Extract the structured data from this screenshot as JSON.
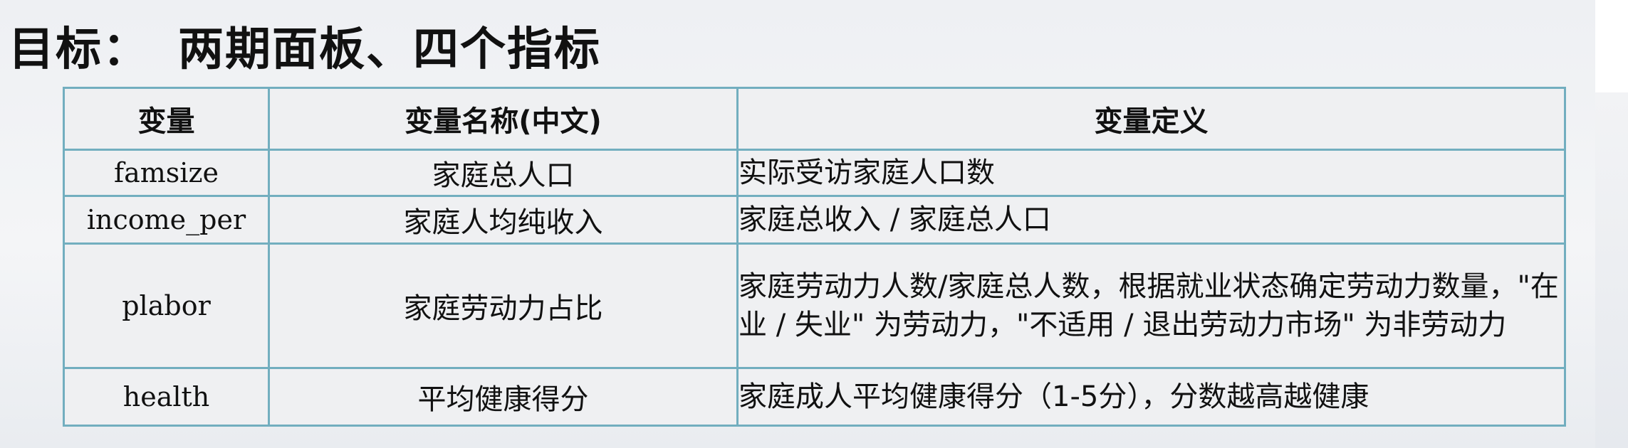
{
  "slide": {
    "title_prefix": "目标：",
    "title_main": "两期面板、四个指标"
  },
  "table": {
    "headers": [
      "变量",
      "变量名称(中文)",
      "变量定义"
    ],
    "rows": [
      {
        "variable": "famsize",
        "name_cn": "家庭总人口",
        "definition": "实际受访家庭人口数"
      },
      {
        "variable": "income_per",
        "name_cn": "家庭人均纯收入",
        "definition": "家庭总收入 / 家庭总人口"
      },
      {
        "variable": "plabor",
        "name_cn": "家庭劳动力占比",
        "definition": "家庭劳动力人数/家庭总人数，根据就业状态确定劳动力数量，\"在业 / 失业\" 为劳动力，\"不适用 / 退出劳动力市场\" 为非劳动力"
      },
      {
        "variable": "health",
        "name_cn": "平均健康得分",
        "definition": "家庭成人平均健康得分（1-5分），分数越高越健康"
      }
    ]
  }
}
